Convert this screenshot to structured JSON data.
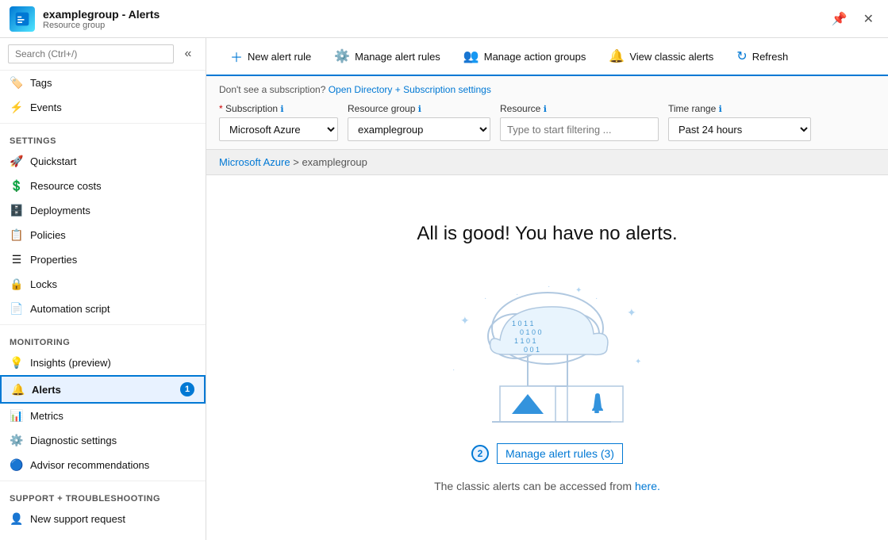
{
  "titleBar": {
    "appName": "examplegroup - Alerts",
    "appSub": "Resource group",
    "controls": [
      "pin-icon",
      "close-icon"
    ]
  },
  "sidebar": {
    "search": {
      "placeholder": "Search (Ctrl+/)"
    },
    "items": [
      {
        "id": "tags",
        "label": "Tags",
        "icon": "🏷️",
        "section": null
      },
      {
        "id": "events",
        "label": "Events",
        "icon": "⚡",
        "section": null
      },
      {
        "id": "settings-section",
        "label": "Settings",
        "isSection": true
      },
      {
        "id": "quickstart",
        "label": "Quickstart",
        "icon": "🚀"
      },
      {
        "id": "resource-costs",
        "label": "Resource costs",
        "icon": "💲"
      },
      {
        "id": "deployments",
        "label": "Deployments",
        "icon": "🗄️"
      },
      {
        "id": "policies",
        "label": "Policies",
        "icon": "📋"
      },
      {
        "id": "properties",
        "label": "Properties",
        "icon": "☰"
      },
      {
        "id": "locks",
        "label": "Locks",
        "icon": "🔒"
      },
      {
        "id": "automation-script",
        "label": "Automation script",
        "icon": "📄"
      },
      {
        "id": "monitoring-section",
        "label": "Monitoring",
        "isSection": true
      },
      {
        "id": "insights",
        "label": "Insights (preview)",
        "icon": "💡"
      },
      {
        "id": "alerts",
        "label": "Alerts",
        "icon": "🔔",
        "active": true,
        "badge": "1"
      },
      {
        "id": "metrics",
        "label": "Metrics",
        "icon": "📊"
      },
      {
        "id": "diagnostic-settings",
        "label": "Diagnostic settings",
        "icon": "⚙️"
      },
      {
        "id": "advisor-recommendations",
        "label": "Advisor recommendations",
        "icon": "🔵"
      },
      {
        "id": "support-section",
        "label": "Support + troubleshooting",
        "isSection": true
      },
      {
        "id": "new-support",
        "label": "New support request",
        "icon": "👤"
      }
    ]
  },
  "toolbar": {
    "newAlertRule": "New alert rule",
    "manageAlertRules": "Manage alert rules",
    "manageActionGroups": "Manage action groups",
    "viewClassicAlerts": "View classic alerts",
    "refresh": "Refresh"
  },
  "filterBar": {
    "subscriptionNote": "Don't see a subscription?",
    "subscriptionLink": "Open Directory + Subscription settings",
    "subscription": {
      "label": "Subscription",
      "value": "Microsoft Azure"
    },
    "resourceGroup": {
      "label": "Resource group",
      "value": "examplegroup"
    },
    "resource": {
      "label": "Resource",
      "placeholder": "Type to start filtering ..."
    },
    "timeRange": {
      "label": "Time range",
      "value": "Past 24 hours"
    }
  },
  "breadcrumb": {
    "parent": "Microsoft Azure",
    "current": "examplegroup"
  },
  "mainContent": {
    "noAlertsTitle": "All is good! You have no alerts.",
    "manageAlertRulesLink": "Manage alert rules (3)",
    "badgeNumber": "2",
    "classicAlertsText": "The classic alerts can be accessed from",
    "classicAlertsLink": "here."
  }
}
